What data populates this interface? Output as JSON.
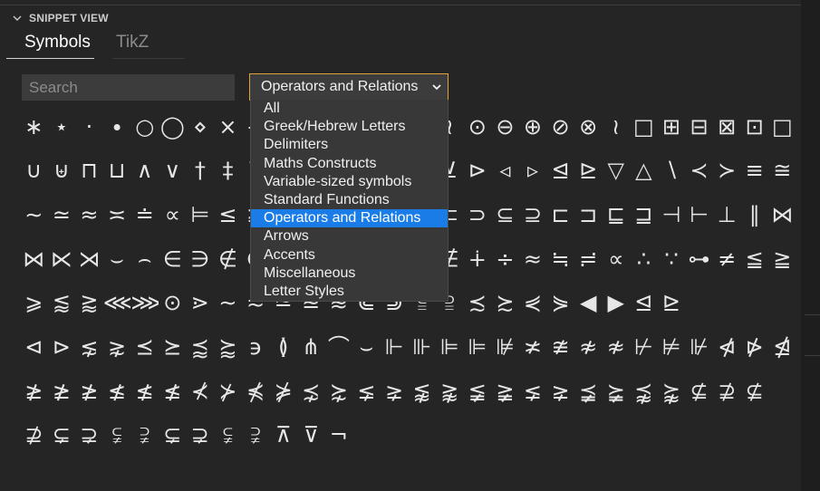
{
  "panel": {
    "section_title": "SNIPPET VIEW",
    "tabs": [
      {
        "label": "Symbols",
        "active": true
      },
      {
        "label": "TikZ",
        "active": false
      }
    ]
  },
  "search": {
    "placeholder": "Search",
    "value": ""
  },
  "category_select": {
    "selected": "Operators and Relations",
    "accent_color": "#e2a33a",
    "options": [
      "All",
      "Greek/Hebrew Letters",
      "Delimiters",
      "Maths Constructs",
      "Variable-sized symbols",
      "Standard Functions",
      "Operators and Relations",
      "Arrows",
      "Accents",
      "Miscellaneous",
      "Letter Styles"
    ],
    "highlight_color": "#1a7ce6"
  },
  "symbols": {
    "rows": [
      [
        "∗",
        "⋆",
        "·",
        "∙",
        "○",
        "◯",
        "⋄",
        "×",
        "÷",
        "∴",
        "⊛",
        "⊖",
        "⊕",
        "⊘",
        "⊗",
        "≀",
        "⊙",
        "⊖",
        "⊕",
        "⊘",
        "⊗",
        "≀",
        "□",
        "⊞",
        "⊟",
        "⊠",
        "⊡",
        "□",
        "∩"
      ],
      [
        "∪",
        "⊎",
        "⊓",
        "⊔",
        "∧",
        "∨",
        "†",
        "‡",
        "⊼",
        "⊻",
        "⊻",
        "⊻",
        "⊻",
        "⊻",
        "⊻",
        "⊻",
        "⊳",
        "◃",
        "▹",
        "⊴",
        "⊵",
        "▽",
        "△",
        "∖",
        "≺",
        "≻",
        "≡",
        "≅",
        "≠"
      ],
      [
        "∼",
        "≃",
        "≈",
        "≍",
        "≐",
        "∝",
        "⊨",
        "≤",
        "≥",
        "≪",
        "≫",
        "≺",
        "≻",
        "⊂",
        "⊃",
        "⊂",
        "⊃",
        "⊆",
        "⊇",
        "⊏",
        "⊐",
        "⊑",
        "⊒",
        "⊣",
        "⊢",
        "⊥",
        "∥",
        "⋈"
      ],
      [
        "⋈",
        "⋉",
        "⋊",
        "⌣",
        "⌢",
        "∈",
        "∋",
        "∉",
        "∉",
        "∉",
        "∉",
        "∉",
        "∉",
        "∉",
        "∉",
        "∉",
        "∔",
        "÷",
        "≈",
        "≒",
        "≓",
        "∝",
        "∴",
        "∵",
        "⊶",
        "≠",
        "≦",
        "≧",
        "⋖"
      ],
      [
        "⩾",
        "⪅",
        "⪆",
        "⋘",
        "⋙",
        "⊙",
        "⋗",
        "∼",
        "≂",
        "≃",
        "≊",
        "≋",
        "⋐",
        "⋑",
        "⫅",
        "⫆",
        "≾",
        "≿",
        "⋞",
        "⋟",
        "◀",
        "▶",
        "⊴",
        "⊵"
      ],
      [
        "⊲",
        "⊳",
        "⋦",
        "⋧",
        "⪯",
        "⪰",
        "⪷",
        "⪸",
        "϶",
        "≬",
        "⋔",
        "⌒",
        "⌣",
        "⊩",
        "⊪",
        "⊫",
        "⊫",
        "⊯",
        "≭",
        "≇",
        "≉",
        "≉",
        "⊬",
        "⊭",
        "⊮",
        "⋪",
        "⋫",
        "⋬",
        "⋭"
      ],
      [
        "≱",
        "≱",
        "≱",
        "≰",
        "≰",
        "≰",
        "⊀",
        "⊁",
        "⋠",
        "⋡",
        "⋨",
        "⋩",
        "⪇",
        "⪈",
        "⪉",
        "⪊",
        "≨",
        "≩",
        "⪇",
        "⪈",
        "⪵",
        "⪶",
        "⪹",
        "⪺",
        "⊈",
        "⊉",
        "⊈"
      ],
      [
        "⊉",
        "⊊",
        "⊋",
        "⫋",
        "⫌",
        "⊊",
        "⊋",
        "⫋",
        "⫌",
        "⊼",
        "⊽",
        "¬"
      ]
    ]
  }
}
